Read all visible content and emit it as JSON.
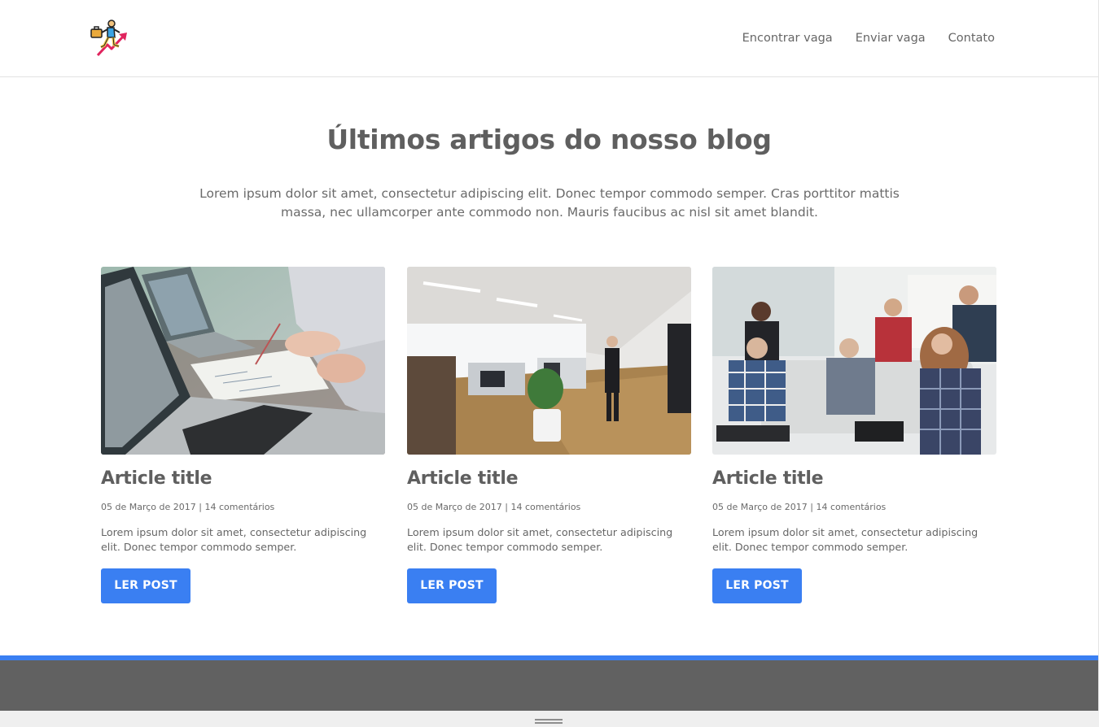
{
  "header": {
    "nav": [
      "Encontrar vaga",
      "Enviar vaga",
      "Contato"
    ]
  },
  "intro": {
    "title": "Últimos artigos do nosso blog",
    "text": "Lorem ipsum dolor sit amet, consectetur adipiscing elit. Donec tempor commodo semper. Cras porttitor mattis massa, nec ullamcorper ante commodo non. Mauris faucibus ac nisl sit amet blandit."
  },
  "cards": [
    {
      "image": "laptops-desk-photo",
      "title": "Article title",
      "meta": "05 de Março de 2017 | 14 comentários",
      "excerpt": "Lorem ipsum dolor sit amet, consectetur adipiscing elit. Donec tempor commodo semper.",
      "button": "LER POST"
    },
    {
      "image": "open-office-photo",
      "title": "Article title",
      "meta": "05 de Março de 2017 | 14 comentários",
      "excerpt": "Lorem ipsum dolor sit amet, consectetur adipiscing elit. Donec tempor commodo semper.",
      "button": "LER POST"
    },
    {
      "image": "team-meeting-photo",
      "title": "Article title",
      "meta": "05 de Março de 2017 | 14 comentários",
      "excerpt": "Lorem ipsum dolor sit amet, consectetur adipiscing elit. Donec tempor commodo semper.",
      "button": "LER POST"
    }
  ],
  "colors": {
    "accent": "#3a7ff2",
    "footer": "#616161",
    "text": "#666666"
  }
}
